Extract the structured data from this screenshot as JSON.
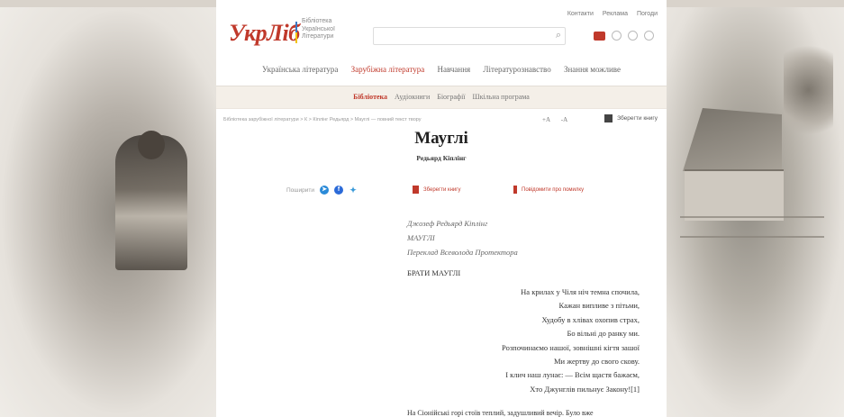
{
  "site": {
    "logo": "УкрЛіб",
    "logo_sub": [
      "Бібліотека",
      "Української",
      "Літератури"
    ],
    "search_placeholder": "",
    "top_links": [
      "Контакти",
      "Реклама",
      "Погоди"
    ]
  },
  "nav": {
    "items": [
      "Українська література",
      "Зарубіжна література",
      "Навчання",
      "Літературознавство",
      "Знання можливе"
    ],
    "active_index": 1
  },
  "subnav": {
    "items": [
      "Бібліотека",
      "Аудіокниги",
      "Біографії",
      "Шкільна програма"
    ],
    "active_index": 0
  },
  "breadcrumbs": "Бібліотека зарубіжної літератури  >  К  >  Кіплінг Редьярд  >  Мауглі — повний текст твору",
  "font_controls": [
    "+A",
    "-A"
  ],
  "save_label": "Зберегти книгу",
  "book": {
    "title": "Мауглі",
    "author": "Редьярд Кіплінг"
  },
  "share": {
    "label": "Поширити"
  },
  "actions": {
    "bookmark": "Зберегти книгу",
    "report": "Повідомити про помилку"
  },
  "text": {
    "header_lines": [
      "Джозеф Редьярд Кіплінг",
      "МАУГЛІ",
      "Переклад Всеволода Протектора"
    ],
    "section_title": "БРАТИ МАУГЛІ",
    "verse": [
      "На крилах у Чіля ніч темна спочила,",
      "Кажан випливе з пітьми,",
      "Худобу в хлівах охопив страх,",
      "Бо вільні до ранку ми.",
      "Розпочинаємо нашої, зовнішні кігтя зашої",
      "Ми жертву до свого скову.",
      "І клич наш лунає: — Всім щастя бажаєм,",
      "Хто Джунглів пильнує Закону![1]"
    ],
    "prose_start": "На Сіонійські горі стоїв теплий, задушливий вечір. Було вже"
  },
  "colors": {
    "accent": "#c0392b",
    "subnav_bg": "#f4efe8",
    "side_bg": "#d9d3cb"
  }
}
